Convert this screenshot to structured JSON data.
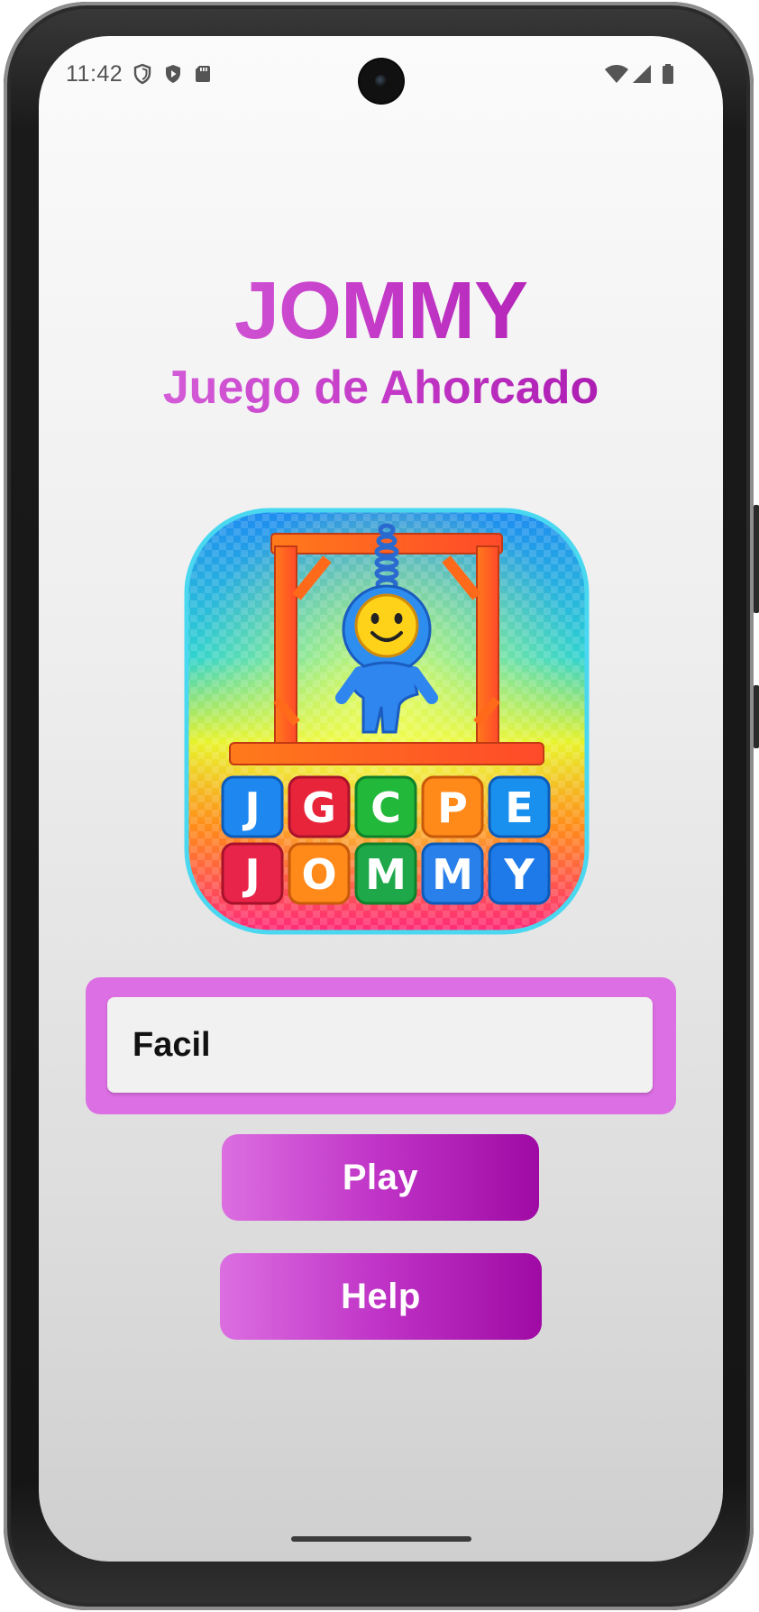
{
  "status_bar": {
    "time": "11:42",
    "left_icons": [
      "shield-outline-icon",
      "play-shield-icon",
      "sd-card-icon"
    ],
    "right_icons": [
      "wifi-icon",
      "cell-signal-icon",
      "battery-icon"
    ]
  },
  "app": {
    "title": "JOMMY",
    "subtitle": "Juego de Ahorcado",
    "logo_icon": "hangman-logo-icon",
    "logo_tiles_row1": [
      "J",
      "G",
      "C",
      "P",
      "E"
    ],
    "logo_tiles_row2": [
      "J",
      "O",
      "M",
      "M",
      "Y"
    ]
  },
  "difficulty": {
    "selected": "Facil"
  },
  "buttons": {
    "play": "Play",
    "help": "Help"
  },
  "colors": {
    "accent_light": "#dc6fe3",
    "accent_dark": "#a00ea6",
    "button_text": "#ffffff"
  }
}
